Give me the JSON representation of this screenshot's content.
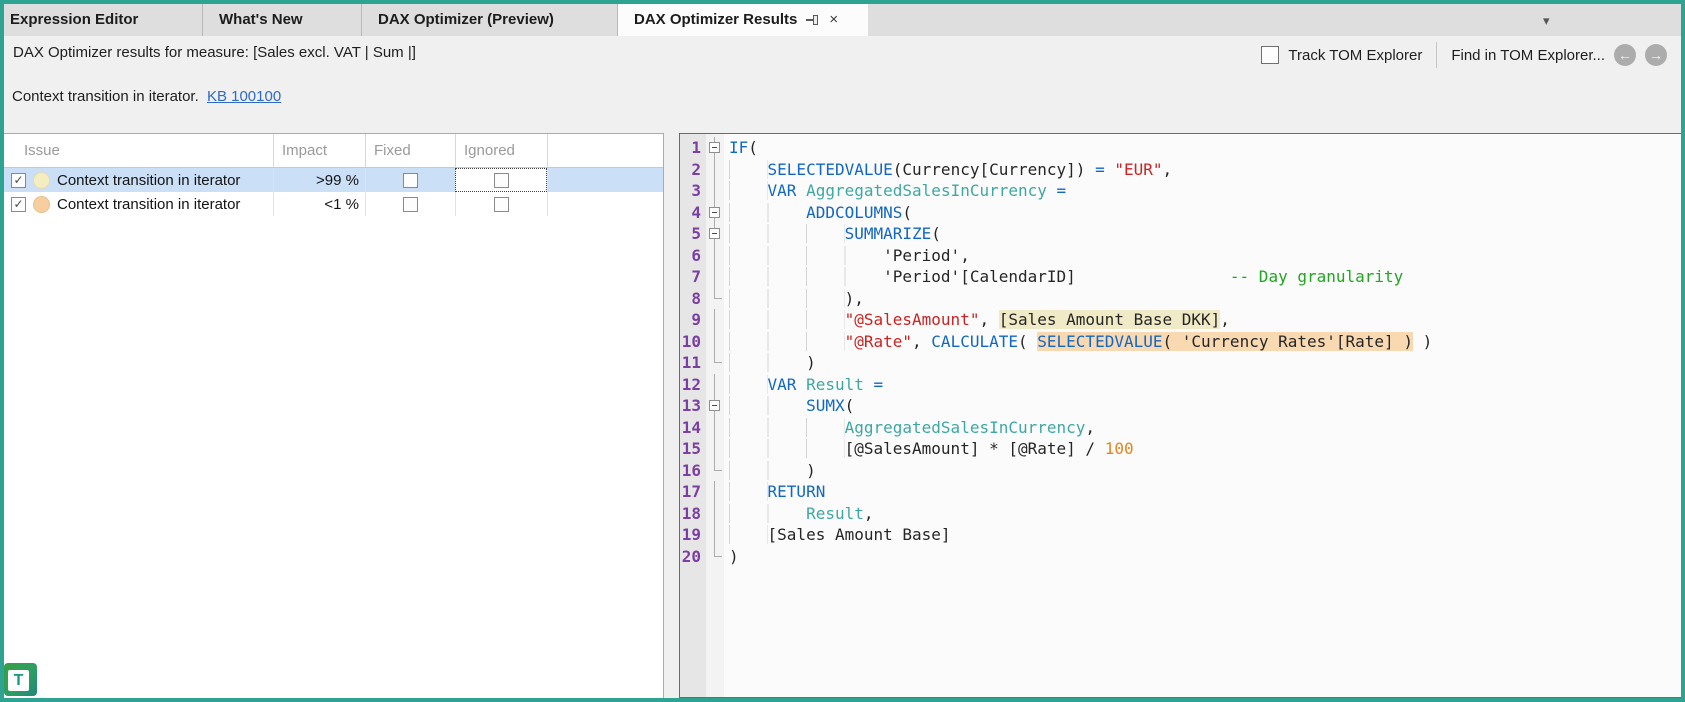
{
  "tabs": [
    {
      "label": "Expression Editor",
      "active": false
    },
    {
      "label": "What's New",
      "active": false
    },
    {
      "label": "DAX Optimizer (Preview)",
      "active": false
    },
    {
      "label": "DAX Optimizer Results",
      "active": true
    }
  ],
  "icons": {
    "close": "×",
    "dropdown": "▾",
    "back_arrow": "←",
    "forward_arrow": "→",
    "check": "✓"
  },
  "header": {
    "title": "DAX Optimizer results for measure: [Sales excl. VAT | Sum |]",
    "track_label": "Track TOM Explorer",
    "track_checked": false,
    "find_label": "Find in TOM Explorer..."
  },
  "issue_summary": {
    "text": "Context transition in iterator.",
    "link": "KB 100100"
  },
  "table": {
    "columns": [
      "Issue",
      "Impact",
      "Fixed",
      "Ignored"
    ],
    "rows": [
      {
        "enabled": true,
        "severity_color": "#F5EDC2",
        "issue": "Context transition in iterator",
        "impact": ">99 %",
        "fixed": false,
        "ignored": false,
        "selected": true
      },
      {
        "enabled": true,
        "severity_color": "#F7CF9E",
        "issue": "Context transition in iterator",
        "impact": "<1 %",
        "fixed": false,
        "ignored": false,
        "selected": false
      }
    ]
  },
  "editor": {
    "colors": {
      "keyword": "#1167C4",
      "variable": "#3DA8A2",
      "string": "#CC2222",
      "comment": "#21A621",
      "number": "#E8821E",
      "line_number": "#7B3FA3",
      "highlight_yellow": "#F1EAC6",
      "highlight_orange": "#F9D9B2"
    },
    "lines": [
      {
        "n": 1,
        "fold": "b",
        "seg": [
          [
            "IF",
            "k"
          ],
          [
            "(",
            ""
          ]
        ]
      },
      {
        "n": 2,
        "fold": "l",
        "seg": [
          [
            "    ",
            "w"
          ],
          [
            "SELECTEDVALUE",
            "k"
          ],
          [
            "(Currency[Currency]) ",
            ""
          ],
          [
            "=",
            "k"
          ],
          [
            " ",
            ""
          ],
          [
            "\"EUR\"",
            "s"
          ],
          [
            ",",
            ""
          ]
        ]
      },
      {
        "n": 3,
        "fold": "l",
        "seg": [
          [
            "    ",
            "w"
          ],
          [
            "VAR",
            "k"
          ],
          [
            " ",
            ""
          ],
          [
            "AggregatedSalesInCurrency",
            "v"
          ],
          [
            " ",
            ""
          ],
          [
            "=",
            "k"
          ]
        ]
      },
      {
        "n": 4,
        "fold": "b",
        "seg": [
          [
            "        ",
            "w"
          ],
          [
            "ADDCOLUMNS",
            "k"
          ],
          [
            "(",
            ""
          ]
        ]
      },
      {
        "n": 5,
        "fold": "b",
        "seg": [
          [
            "            ",
            "w"
          ],
          [
            "SUMMARIZE",
            "k"
          ],
          [
            "(",
            ""
          ]
        ]
      },
      {
        "n": 6,
        "fold": "l",
        "seg": [
          [
            "                ",
            "w"
          ],
          [
            "'Period',",
            ""
          ]
        ]
      },
      {
        "n": 7,
        "fold": "l",
        "seg": [
          [
            "                ",
            "w"
          ],
          [
            "'Period'[CalendarID]",
            ""
          ],
          [
            "                ",
            ""
          ],
          [
            "-- Day granularity",
            "c"
          ]
        ]
      },
      {
        "n": 8,
        "fold": "e",
        "seg": [
          [
            "            ",
            "w"
          ],
          [
            "),",
            ""
          ]
        ]
      },
      {
        "n": 9,
        "fold": "l",
        "seg": [
          [
            "            ",
            "w"
          ],
          [
            "\"@SalesAmount\"",
            "s"
          ],
          [
            ", ",
            ""
          ],
          [
            "[Sales Amount Base DKK]",
            "y"
          ],
          [
            ",",
            ""
          ]
        ]
      },
      {
        "n": 10,
        "fold": "l",
        "seg": [
          [
            "            ",
            "w"
          ],
          [
            "\"@Rate\"",
            "s"
          ],
          [
            ", ",
            ""
          ],
          [
            "CALCULATE",
            "k"
          ],
          [
            "( ",
            ""
          ],
          [
            "SELECTEDVALUE",
            "k o"
          ],
          [
            "( 'Currency Rates'[Rate] )",
            "o"
          ],
          [
            " )",
            ""
          ]
        ]
      },
      {
        "n": 11,
        "fold": "e",
        "seg": [
          [
            "        ",
            "w"
          ],
          [
            ")",
            ""
          ]
        ]
      },
      {
        "n": 12,
        "fold": "l",
        "seg": [
          [
            "    ",
            "w"
          ],
          [
            "VAR",
            "k"
          ],
          [
            " ",
            ""
          ],
          [
            "Result",
            "v"
          ],
          [
            " ",
            ""
          ],
          [
            "=",
            "k"
          ]
        ]
      },
      {
        "n": 13,
        "fold": "b",
        "seg": [
          [
            "        ",
            "w"
          ],
          [
            "SUMX",
            "k"
          ],
          [
            "(",
            ""
          ]
        ]
      },
      {
        "n": 14,
        "fold": "l",
        "seg": [
          [
            "            ",
            "w"
          ],
          [
            "AggregatedSalesInCurrency",
            "v"
          ],
          [
            ",",
            ""
          ]
        ]
      },
      {
        "n": 15,
        "fold": "l",
        "seg": [
          [
            "            ",
            "w"
          ],
          [
            "[@SalesAmount] * [@Rate] / ",
            ""
          ],
          [
            "100",
            "n"
          ]
        ]
      },
      {
        "n": 16,
        "fold": "e",
        "seg": [
          [
            "        ",
            "w"
          ],
          [
            ")",
            ""
          ]
        ]
      },
      {
        "n": 17,
        "fold": "l",
        "seg": [
          [
            "    ",
            "w"
          ],
          [
            "RETURN",
            "k"
          ]
        ]
      },
      {
        "n": 18,
        "fold": "l",
        "seg": [
          [
            "        ",
            "w"
          ],
          [
            "Result",
            "v"
          ],
          [
            ",",
            ""
          ]
        ]
      },
      {
        "n": 19,
        "fold": "l",
        "seg": [
          [
            "    ",
            "w"
          ],
          [
            "[Sales Amount Base]",
            ""
          ]
        ]
      },
      {
        "n": 20,
        "fold": "e",
        "seg": [
          [
            ")",
            ""
          ]
        ]
      }
    ]
  },
  "logo_letter": "T"
}
